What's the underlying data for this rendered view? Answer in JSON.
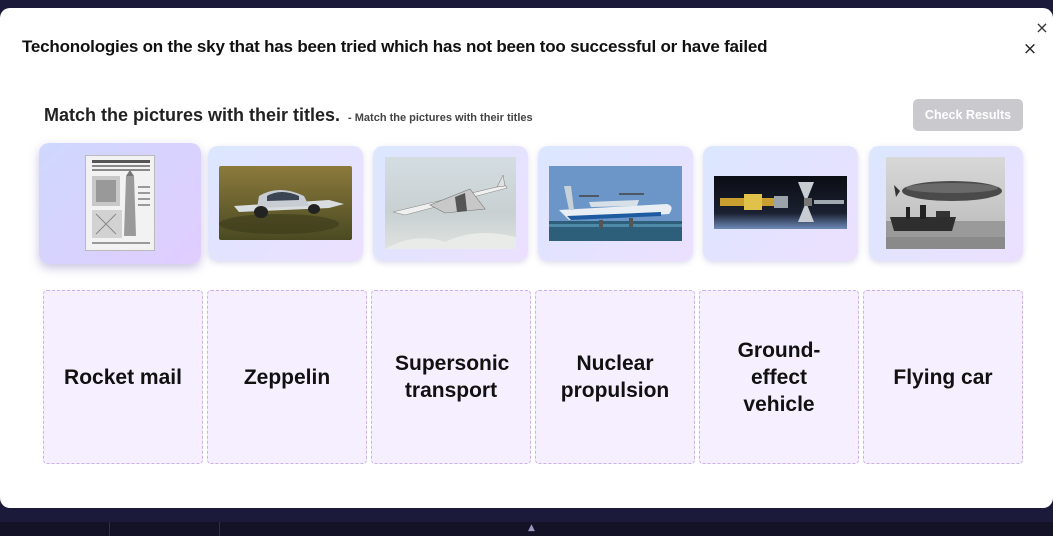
{
  "modal": {
    "title": "Techonologies on the sky that has been tried which has not been too successful or have failed",
    "close_symbol": "×"
  },
  "outer_close_symbol": "×",
  "instructions": {
    "main": "Match the pictures with their titles.",
    "sub": "- Match the pictures with their titles"
  },
  "check_button": {
    "label": "Check Results"
  },
  "pictures": [
    {
      "icon": "newspaper-clipping-image"
    },
    {
      "icon": "flying-car-image"
    },
    {
      "icon": "supersonic-jet-image"
    },
    {
      "icon": "ground-effect-vehicle-image"
    },
    {
      "icon": "nuclear-engine-image"
    },
    {
      "icon": "zeppelin-image"
    }
  ],
  "targets": [
    {
      "label": "Rocket mail"
    },
    {
      "label": "Zeppelin"
    },
    {
      "label": "Supersonic transport"
    },
    {
      "label": "Nuclear propulsion"
    },
    {
      "label": "Ground-effect vehicle"
    },
    {
      "label": "Flying car"
    }
  ],
  "colors": {
    "accent_card": "#e6dfff",
    "drop_zone_bg": "#f6efff",
    "drop_zone_border": "#c9b2e6",
    "button_disabled": "#c9c9ce"
  }
}
